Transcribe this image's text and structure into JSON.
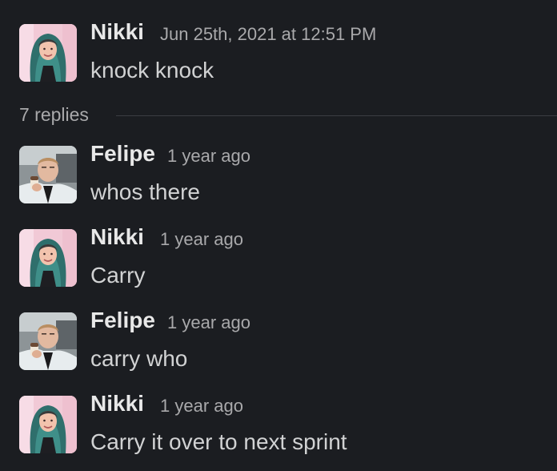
{
  "thread": {
    "parent": {
      "author": "Nikki",
      "timestamp": "Jun 25th, 2021 at 12:51 PM",
      "text": "knock knock",
      "avatar": "nikki-avatar"
    },
    "replies_label": "7 replies",
    "replies": [
      {
        "author": "Felipe",
        "timestamp": "1 year ago",
        "text": "whos there",
        "avatar": "felipe-avatar"
      },
      {
        "author": "Nikki",
        "timestamp": "1 year ago",
        "text": "Carry",
        "avatar": "nikki-avatar"
      },
      {
        "author": "Felipe",
        "timestamp": "1 year ago",
        "text": "carry who",
        "avatar": "felipe-avatar"
      },
      {
        "author": "Nikki",
        "timestamp": "1 year ago",
        "text": "Carry it over to next sprint",
        "avatar": "nikki-avatar"
      }
    ]
  },
  "colors": {
    "background": "#1b1d21",
    "author": "#e8e8e8",
    "text": "#d1d2d3",
    "muted": "#a9a9ab",
    "divider": "#3b3d42"
  }
}
